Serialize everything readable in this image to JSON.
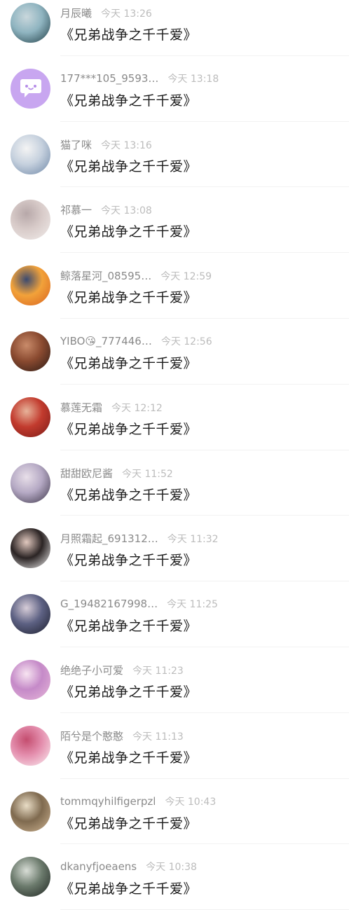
{
  "comments": [
    {
      "name": "月辰曦",
      "time": "今天 13:26",
      "text": "《兄弟战争之千千爱》",
      "avatar": "avatar-illustration",
      "colors": [
        "#1f3d45",
        "#8fb4c0",
        "#c9d7dc"
      ]
    },
    {
      "name": "177***105_9593…",
      "time": "今天 13:18",
      "text": "《兄弟战争之千千爱》",
      "avatar": "chat-bubble-icon",
      "colors": [
        "#c8a6f0",
        "#ffffff",
        "#b68de8"
      ]
    },
    {
      "name": "猫了咪",
      "time": "今天 13:16",
      "text": "《兄弟战争之千千爱》",
      "avatar": "avatar-sky-photo",
      "colors": [
        "#6d86a6",
        "#c6d1de",
        "#f4f4f4"
      ]
    },
    {
      "name": "祁慕一",
      "time": "今天 13:08",
      "text": "《兄弟战争之千千爱》",
      "avatar": "avatar-anime-girl",
      "colors": [
        "#f1ecea",
        "#d8cbc9",
        "#b7a8a9"
      ]
    },
    {
      "name": "鲸落星河_08595…",
      "time": "今天 12:59",
      "text": "《兄弟战争之千千爱》",
      "avatar": "avatar-orange-art",
      "colors": [
        "#d8621e",
        "#f2a23a",
        "#3b4a70"
      ]
    },
    {
      "name": "YIBO😘_777446…",
      "time": "今天 12:56",
      "text": "《兄弟战争之千千爱》",
      "avatar": "avatar-portrait-dark",
      "colors": [
        "#2a1a14",
        "#8a4a30",
        "#c98b6a"
      ]
    },
    {
      "name": "慕莲无霜",
      "time": "今天 12:12",
      "text": "《兄弟战争之千千爱》",
      "avatar": "avatar-red-costume",
      "colors": [
        "#7a1a16",
        "#c23b2e",
        "#e7b39a"
      ]
    },
    {
      "name": "甜甜欧尼酱",
      "time": "今天 11:52",
      "text": "《兄弟战争之千千爱》",
      "avatar": "avatar-idol-photo",
      "colors": [
        "#3b3447",
        "#b5a9c4",
        "#e8dfe9"
      ]
    },
    {
      "name": "月照霜起_691312…",
      "time": "今天 11:32",
      "text": "《兄弟战争之千千爱》",
      "avatar": "avatar-two-girls",
      "colors": [
        "#f4f4f4",
        "#2b2424",
        "#e2c9bf"
      ]
    },
    {
      "name": "G_19482167998…",
      "time": "今天 11:25",
      "text": "《兄弟战争之千千爱》",
      "avatar": "avatar-night-photo",
      "colors": [
        "#1c1e2c",
        "#5d6183",
        "#d7cdd8"
      ]
    },
    {
      "name": "绝绝子小可爱",
      "time": "今天 11:23",
      "text": "《兄弟战争之千千爱》",
      "avatar": "avatar-pink-anime",
      "colors": [
        "#e7b7d9",
        "#c58ac8",
        "#f7e4f1"
      ]
    },
    {
      "name": "陌兮是个憨憨",
      "time": "今天 11:13",
      "text": "《兄弟战争之千千爱》",
      "avatar": "avatar-blossom-art",
      "colors": [
        "#fbeef2",
        "#e48fae",
        "#c44d6f"
      ]
    },
    {
      "name": "tommqyhilfigerpzl",
      "time": "今天 10:43",
      "text": "《兄弟战争之千千爱》",
      "avatar": "avatar-railway-photo",
      "colors": [
        "#cdb391",
        "#7f6a4f",
        "#e9ddc6"
      ]
    },
    {
      "name": "dkanyfjoeaens",
      "time": "今天 10:38",
      "text": "《兄弟战争之千千爱》",
      "avatar": "avatar-boy-photo",
      "colors": [
        "#1e2420",
        "#6b7a6c",
        "#d8ddd6"
      ]
    }
  ]
}
